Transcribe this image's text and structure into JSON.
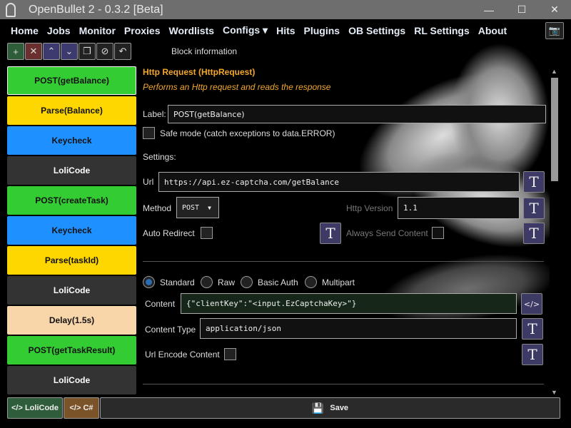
{
  "window": {
    "title": "OpenBullet 2 - 0.3.2 [Beta]",
    "minimize": "—",
    "maximize": "☐",
    "close": "✕"
  },
  "nav": [
    "Home",
    "Jobs",
    "Monitor",
    "Proxies",
    "Wordlists",
    "Configs ▾",
    "Hits",
    "Plugins",
    "OB Settings",
    "RL Settings",
    "About"
  ],
  "toolbar": {
    "add": "+",
    "remove": "✕",
    "up": "⌃",
    "down": "⌄",
    "clone": "❐",
    "disable": "⊘",
    "undo": "↶"
  },
  "blocks": [
    {
      "label": "POST(getBalance)",
      "color": "#33cc33",
      "selected": true
    },
    {
      "label": "Parse(Balance)",
      "color": "#ffd700"
    },
    {
      "label": "Keycheck",
      "color": "#1e90ff"
    },
    {
      "label": "LoliCode",
      "color": "#333333",
      "text": "#ffffff"
    },
    {
      "label": "POST(createTask)",
      "color": "#33cc33"
    },
    {
      "label": "Keycheck",
      "color": "#1e90ff"
    },
    {
      "label": "Parse(taskId)",
      "color": "#ffd700"
    },
    {
      "label": "LoliCode",
      "color": "#333333",
      "text": "#ffffff"
    },
    {
      "label": "Delay(1.5s)",
      "color": "#f9d5aa"
    },
    {
      "label": "POST(getTaskResult)",
      "color": "#33cc33"
    },
    {
      "label": "LoliCode",
      "color": "#333333",
      "text": "#ffffff"
    },
    {
      "label": "",
      "color": "#ffd700"
    }
  ],
  "info": {
    "header": "Block information",
    "title": "Http Request (HttpRequest)",
    "description": "Performs an Http request and reads the response",
    "label_label": "Label:",
    "label_value": "POST(getBalance)",
    "safe_mode": "Safe mode (catch exceptions to data.ERROR)",
    "settings": "Settings:",
    "url_label": "Url",
    "url_value": "https://api.ez-captcha.com/getBalance",
    "method_label": "Method",
    "method_value": "POST",
    "http_version_label": "Http Version",
    "http_version_value": "1.1",
    "auto_redirect": "Auto Redirect",
    "always_send": "Always Send Content",
    "radios": [
      "Standard",
      "Raw",
      "Basic Auth",
      "Multipart"
    ],
    "content_label": "Content",
    "content_value": "{\"clientKey\":\"<input.EzCaptchaKey>\"}",
    "content_type_label": "Content Type",
    "content_type_value": "application/json",
    "url_encode": "Url Encode Content",
    "t_icon": "T",
    "code_icon": "</>"
  },
  "footer": {
    "lolicode": "</> LoliCode",
    "csharp": "</> C#",
    "save": "Save"
  }
}
